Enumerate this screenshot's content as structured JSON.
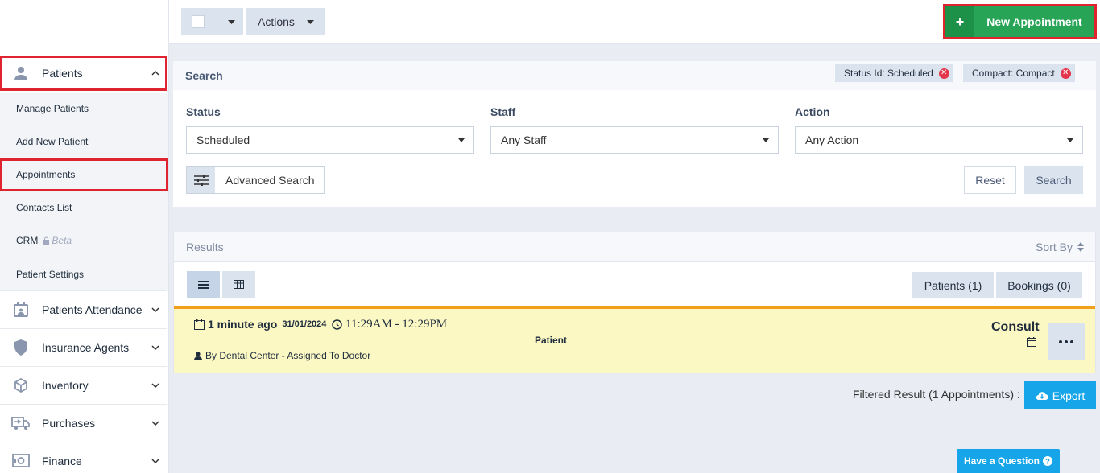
{
  "sidebar": {
    "patients_label": "Patients",
    "submenu": [
      {
        "label": "Manage Patients"
      },
      {
        "label": "Add New Patient"
      },
      {
        "label": "Appointments"
      },
      {
        "label": "Contacts List"
      },
      {
        "label": "CRM",
        "badge": "Beta"
      },
      {
        "label": "Patient Settings"
      }
    ],
    "groups": [
      {
        "label": "Patients Attendance",
        "icon": "calendar-user-icon"
      },
      {
        "label": "Insurance Agents",
        "icon": "shield-icon"
      },
      {
        "label": "Inventory",
        "icon": "box-icon"
      },
      {
        "label": "Purchases",
        "icon": "truck-icon"
      },
      {
        "label": "Finance",
        "icon": "safe-icon"
      }
    ]
  },
  "toolbar": {
    "actions_label": "Actions",
    "new_appointment_label": "New Appointment"
  },
  "search": {
    "title": "Search",
    "chips": [
      "Status Id: Scheduled",
      "Compact: Compact"
    ],
    "status_label": "Status",
    "status_value": "Scheduled",
    "staff_label": "Staff",
    "staff_value": "Any Staff",
    "action_label": "Action",
    "action_value": "Any Action",
    "advanced_label": "Advanced Search",
    "reset_label": "Reset",
    "search_label": "Search"
  },
  "results": {
    "title": "Results",
    "sort_label": "Sort By",
    "tab_patients": "Patients (1)",
    "tab_bookings": "Bookings (0)",
    "appointment": {
      "when": "1 minute ago",
      "date": "31/01/2024",
      "time": "11:29AM - 12:29PM",
      "patient": "Patient",
      "by": "By Dental Center - Assigned To Doctor",
      "type": "Consult"
    },
    "filtered_text": "Filtered Result (1 Appointments) :",
    "export_label": "Export"
  },
  "help": {
    "label": "Have a Question"
  },
  "colors": {
    "accent_green": "#27a456",
    "highlight_red": "#e0242f",
    "export_blue": "#16a5e8",
    "row_yellow": "#fbf8c4",
    "row_border": "#f2a01c"
  }
}
